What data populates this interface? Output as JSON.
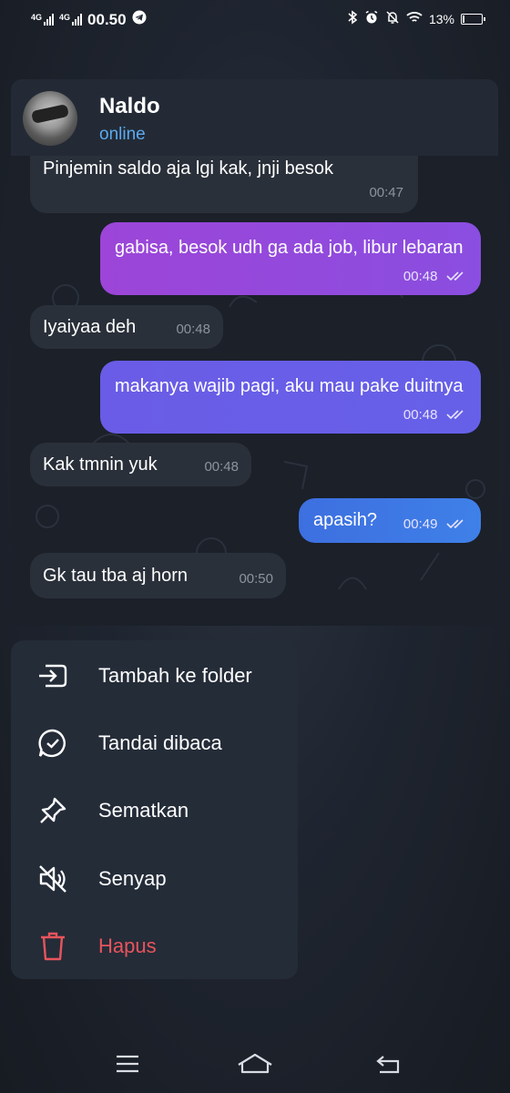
{
  "status_bar": {
    "network_1": "4G",
    "network_2": "4G",
    "time": "00.50",
    "battery_percent_text": "13%",
    "battery_level": 0.13,
    "icons": [
      "bluetooth-icon",
      "alarm-icon",
      "mute-icon",
      "wifi-icon",
      "battery-icon",
      "telegram-icon"
    ]
  },
  "chat": {
    "contact_name": "Naldo",
    "contact_status": "online",
    "messages": [
      {
        "direction": "in",
        "text": "Pinjemin saldo aja lgi kak, jnji besok",
        "time": "00:47"
      },
      {
        "direction": "out",
        "text": "gabisa, besok udh ga ada job, libur lebaran",
        "time": "00:48",
        "read": true
      },
      {
        "direction": "in",
        "text": "Iyaiyaa deh",
        "time": "00:48"
      },
      {
        "direction": "out",
        "text": "makanya wajib pagi, aku mau pake duitnya",
        "time": "00:48",
        "read": true
      },
      {
        "direction": "in",
        "text": "Kak tmnin yuk",
        "time": "00:48"
      },
      {
        "direction": "out",
        "text": "apasih?",
        "time": "00:49",
        "read": true
      },
      {
        "direction": "in",
        "text": "Gk tau tba aj horn",
        "time": "00:50"
      }
    ]
  },
  "menu": {
    "items": [
      {
        "label": "Tambah ke folder",
        "icon": "folder-add-icon",
        "danger": false
      },
      {
        "label": "Tandai dibaca",
        "icon": "chat-check-icon",
        "danger": false
      },
      {
        "label": "Sematkan",
        "icon": "pin-icon",
        "danger": false
      },
      {
        "label": "Senyap",
        "icon": "mute-speaker-icon",
        "danger": false
      },
      {
        "label": "Hapus",
        "icon": "trash-icon",
        "danger": true
      }
    ]
  },
  "nav": {
    "icons": [
      "menu-icon",
      "home-icon",
      "back-icon"
    ]
  },
  "colors": {
    "accent_blue": "#5aaaf0",
    "danger_red": "#e8545c",
    "bubble_in": "#2a303a",
    "bubble_out_purple": "#8e44d8",
    "bubble_out_blue": "#3d7ae6"
  }
}
